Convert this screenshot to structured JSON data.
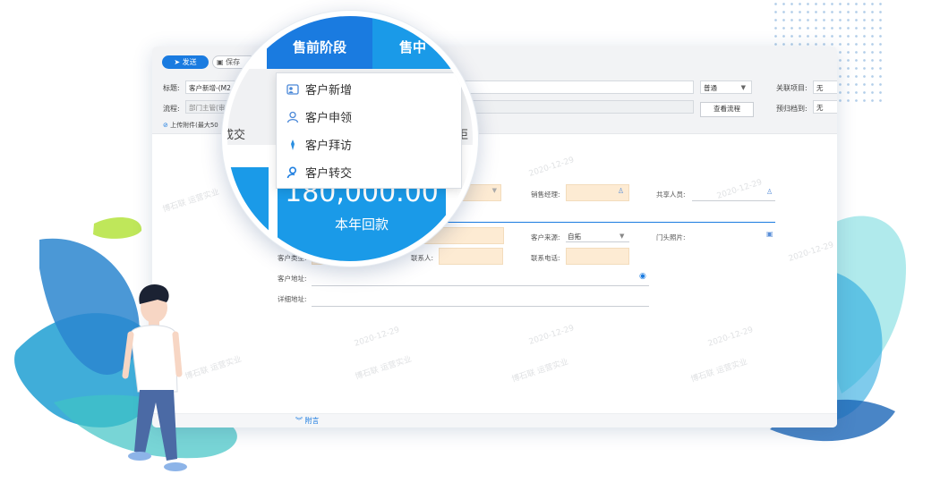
{
  "toolbar": {
    "send_label": "发送",
    "save_label": "保存"
  },
  "form_header": {
    "title_label": "标题:",
    "title_value": "客户新增-(M2",
    "priority_value": "普通",
    "related_project_label": "关联项目:",
    "related_project_value": "无",
    "flow_label": "流程:",
    "flow_value": "部门主管(审",
    "view_flow_label": "查看流程",
    "archive_label": "预归档到:",
    "archive_value": "无",
    "attach_label": "上传附件(最大50"
  },
  "magnifier": {
    "tab_active": "售前阶段",
    "tab_next": "售中",
    "peek_left": "成交",
    "peek_right": "拒",
    "dropdown_items": [
      {
        "label": "客户新增",
        "icon": "customer-add-icon"
      },
      {
        "label": "客户申领",
        "icon": "customer-claim-icon"
      },
      {
        "label": "客户拜访",
        "icon": "customer-visit-icon"
      },
      {
        "label": "客户转交",
        "icon": "customer-transfer-icon"
      }
    ],
    "amount": "180,000.00",
    "amount_label": "本年回款"
  },
  "form": {
    "sales_manager_label": "销售经理:",
    "shared_people_label": "共享人员:",
    "customer_source_label": "客户来源:",
    "customer_source_value": "自拓",
    "door_photo_label": "门头照片:",
    "customer_type_label": "客户类型:",
    "contact_label": "联系人:",
    "phone_label": "联系电话:",
    "address_label": "客户地址:",
    "detail_address_label": "详细地址:"
  },
  "watermarks": {
    "line1": "2020-12-29",
    "line2": "博石联 运营实业"
  },
  "footer": {
    "annex_label": "附言"
  },
  "colors": {
    "primary": "#1a7be0",
    "accent": "#1a9ae8",
    "field_highlight": "#fdebd3"
  }
}
